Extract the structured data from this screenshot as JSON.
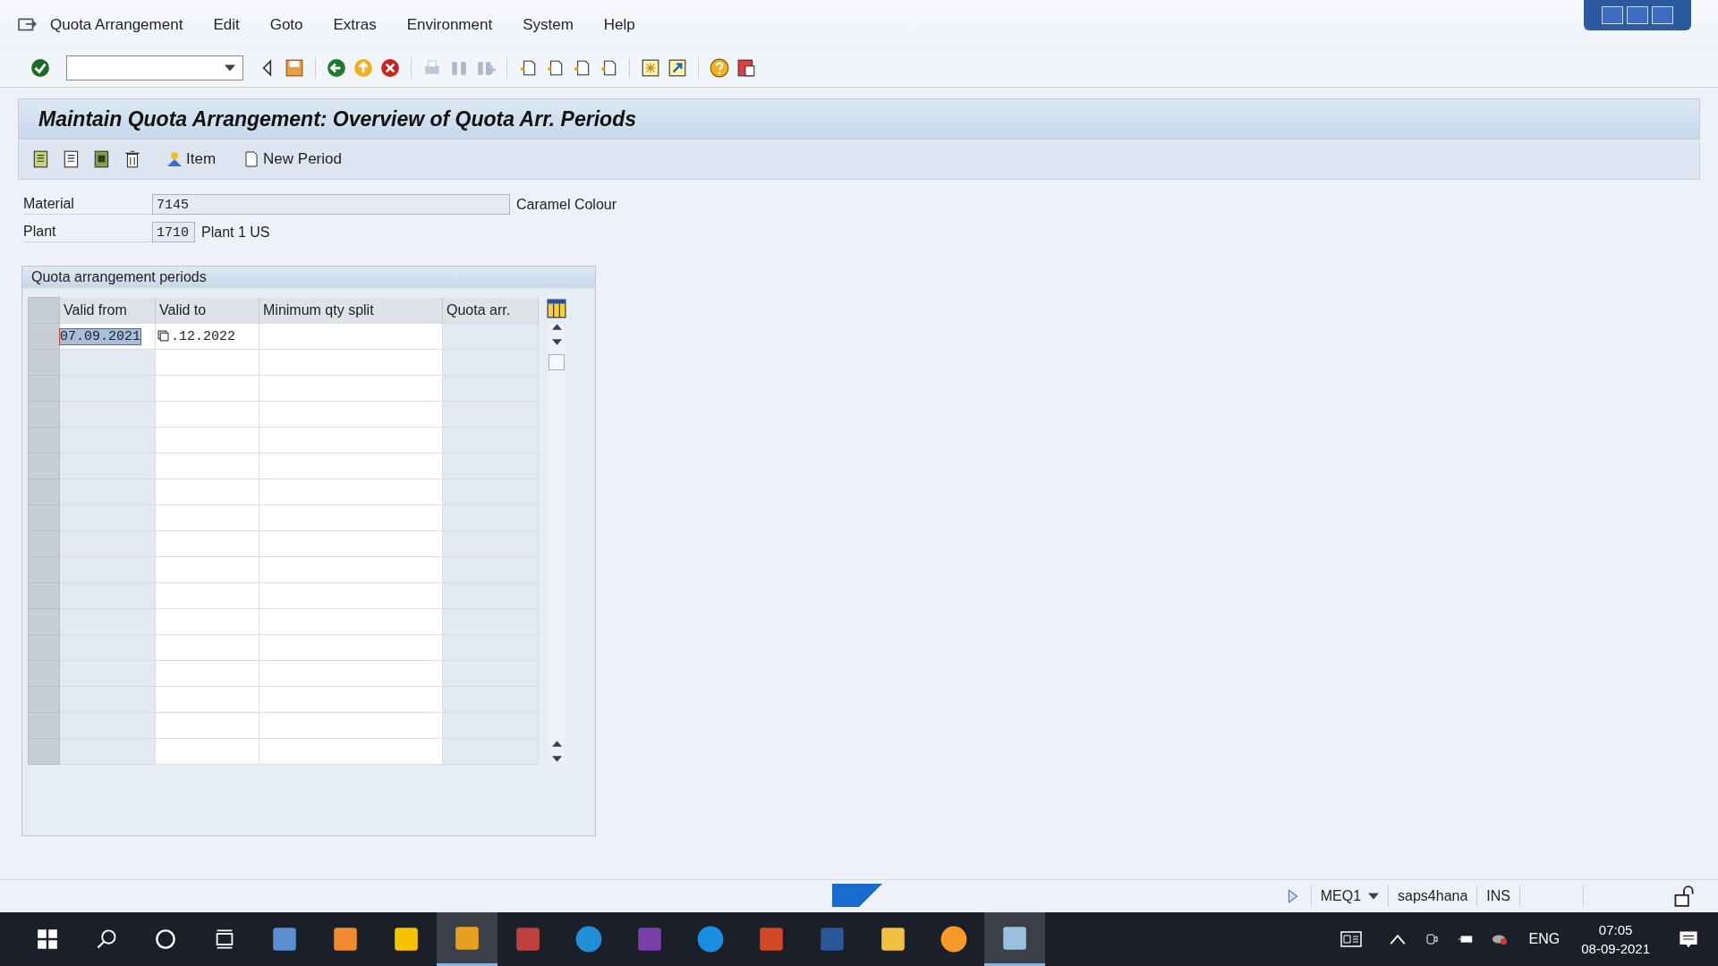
{
  "menu": [
    "Quota Arrangement",
    "Edit",
    "Goto",
    "Extras",
    "Environment",
    "System",
    "Help"
  ],
  "title": "Maintain Quota Arrangement: Overview of Quota Arr. Periods",
  "app_toolbar": {
    "item_button": "Item",
    "new_period_button": "New Period"
  },
  "fields": [
    {
      "label": "Material",
      "value": "7145",
      "description": "Caramel Colour",
      "kind": "wide"
    },
    {
      "label": "Plant",
      "value": "1710",
      "description": "Plant 1 US",
      "kind": "short"
    }
  ],
  "group": {
    "title": "Quota arrangement periods",
    "columns": [
      "Valid from",
      "Valid to",
      "Minimum qty split",
      "Quota arr."
    ],
    "rows": [
      {
        "valid_from": "07.09.2021",
        "valid_to": ".12.2022",
        "selected": true
      }
    ]
  },
  "status_bar": {
    "system": "MEQ1",
    "server": "saps4hana",
    "mode": "INS"
  },
  "taskbar": {
    "language": "ENG",
    "time": "07:05",
    "date": "08-09-2021",
    "apps": [
      {
        "kind": "calculator",
        "selected": false
      },
      {
        "kind": "player",
        "selected": false
      },
      {
        "kind": "notes",
        "selected": false
      },
      {
        "kind": "sap",
        "selected": true
      },
      {
        "kind": "snip",
        "selected": false
      },
      {
        "kind": "edge",
        "selected": false
      },
      {
        "kind": "onenote",
        "selected": false
      },
      {
        "kind": "skype",
        "selected": false
      },
      {
        "kind": "powerpoint",
        "selected": false
      },
      {
        "kind": "word",
        "selected": false
      },
      {
        "kind": "folder",
        "selected": false
      },
      {
        "kind": "flower",
        "selected": false
      },
      {
        "kind": "pad",
        "selected": true
      }
    ]
  }
}
